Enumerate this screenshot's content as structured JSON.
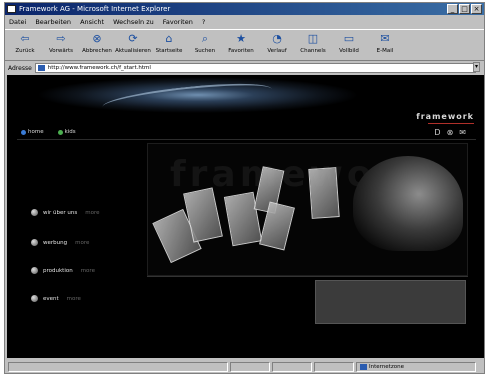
{
  "window": {
    "title": "Framework AG - Microsoft Internet Explorer"
  },
  "menu": [
    "Datei",
    "Bearbeiten",
    "Ansicht",
    "Wechseln zu",
    "Favoriten",
    "?"
  ],
  "toolbar": [
    {
      "label": "Zurück",
      "icon": "back-icon",
      "glyph": "⇦"
    },
    {
      "label": "Vorwärts",
      "icon": "forward-icon",
      "glyph": "⇨"
    },
    {
      "label": "Abbrechen",
      "icon": "stop-icon",
      "glyph": "⊗"
    },
    {
      "label": "Aktualisieren",
      "icon": "refresh-icon",
      "glyph": "⟳"
    },
    {
      "label": "Startseite",
      "icon": "home-icon",
      "glyph": "⌂"
    },
    {
      "label": "Suchen",
      "icon": "search-icon",
      "glyph": "⌕"
    },
    {
      "label": "Favoriten",
      "icon": "favorites-icon",
      "glyph": "★"
    },
    {
      "label": "Verlauf",
      "icon": "history-icon",
      "glyph": "◔"
    },
    {
      "label": "Channels",
      "icon": "channels-icon",
      "glyph": "◫"
    },
    {
      "label": "Vollbild",
      "icon": "fullscreen-icon",
      "glyph": "▭"
    },
    {
      "label": "E-Mail",
      "icon": "mail-icon",
      "glyph": "✉"
    }
  ],
  "address": {
    "label": "Adresse",
    "url": "http://www.framework.ch/f_start.html"
  },
  "site": {
    "logo": "framework",
    "topnav": [
      {
        "label": "home",
        "color": "#3a7bd5"
      },
      {
        "label": "kids",
        "color": "#4caf50"
      }
    ],
    "top_icons": [
      "D",
      "⊗",
      "✉"
    ],
    "side_nav": [
      {
        "label": "wir über uns",
        "more": "more"
      },
      {
        "label": "werbung",
        "more": "more"
      },
      {
        "label": "produktion",
        "more": "more"
      },
      {
        "label": "event",
        "more": "more"
      }
    ],
    "stage_bg_text": "framework"
  },
  "status": {
    "zone": "Internetzone"
  }
}
